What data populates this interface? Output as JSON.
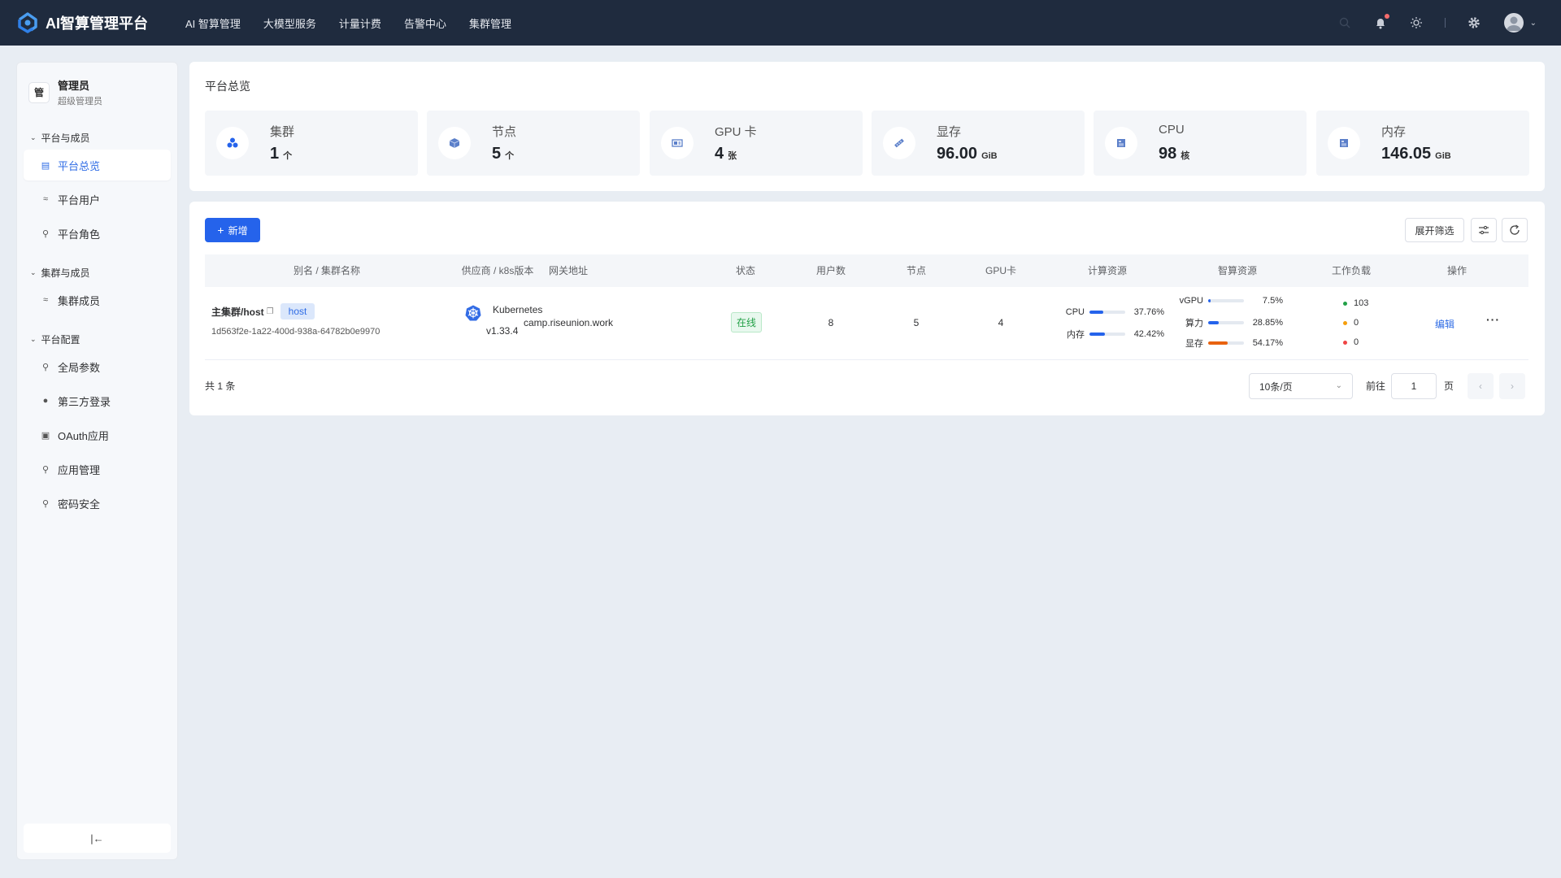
{
  "app": {
    "title": "AI智算管理平台",
    "nav": [
      "AI 智算管理",
      "大模型服务",
      "计量计费",
      "告警中心",
      "集群管理"
    ]
  },
  "user": {
    "avatar_text": "管",
    "name": "管理员",
    "role": "超级管理员"
  },
  "sidebar": {
    "groups": [
      {
        "title": "平台与成员",
        "items": [
          {
            "label": "平台总览",
            "icon": "dashboard-icon",
            "active": true
          },
          {
            "label": "平台用户",
            "icon": "user-group-icon"
          },
          {
            "label": "平台角色",
            "icon": "user-role-icon"
          }
        ]
      },
      {
        "title": "集群与成员",
        "items": [
          {
            "label": "集群成员",
            "icon": "member-icon"
          }
        ]
      },
      {
        "title": "平台配置",
        "items": [
          {
            "label": "全局参数",
            "icon": "key-icon"
          },
          {
            "label": "第三方登录",
            "icon": "login-icon"
          },
          {
            "label": "OAuth应用",
            "icon": "app-icon"
          },
          {
            "label": "应用管理",
            "icon": "key-icon"
          },
          {
            "label": "密码安全",
            "icon": "key-icon"
          }
        ]
      }
    ],
    "collapse_label": "|←"
  },
  "overview": {
    "title": "平台总览",
    "stats": [
      {
        "label": "集群",
        "value": "1",
        "unit": "个",
        "icon": "cluster-icon"
      },
      {
        "label": "节点",
        "value": "5",
        "unit": "个",
        "icon": "node-icon"
      },
      {
        "label": "GPU 卡",
        "value": "4",
        "unit": "张",
        "icon": "gpu-icon"
      },
      {
        "label": "显存",
        "value": "96.00",
        "unit": "GiB",
        "icon": "memory-stick-icon"
      },
      {
        "label": "CPU",
        "value": "98",
        "unit": "核",
        "icon": "cpu-icon"
      },
      {
        "label": "内存",
        "value": "146.05",
        "unit": "GiB",
        "icon": "ram-icon"
      }
    ]
  },
  "clusters": {
    "new_button": "新增",
    "filter_button": "展开筛选",
    "headers": [
      "别名 / 集群名称",
      "供应商 / k8s版本",
      "网关地址",
      "状态",
      "用户数",
      "节点",
      "GPU卡",
      "计算资源",
      "智算资源",
      "工作负载",
      "操作"
    ],
    "rows": [
      {
        "alias": "主集群/host",
        "tag": "host",
        "cluster_id": "1d563f2e-1a22-400d-938a-64782b0e9970",
        "provider": "Kubernetes",
        "version": "v1.33.4",
        "gateway": "camp.riseunion.work",
        "status": "在线",
        "users": "8",
        "nodes": "5",
        "gpus": "4",
        "compute": [
          {
            "label": "CPU",
            "value": "37.76%",
            "percent": 37.76,
            "color": "#2563eb"
          },
          {
            "label": "内存",
            "value": "42.42%",
            "percent": 42.42,
            "color": "#2563eb"
          }
        ],
        "ai": [
          {
            "label": "vGPU",
            "value": "7.5%",
            "percent": 7.5,
            "color": "#2563eb"
          },
          {
            "label": "算力",
            "value": "28.85%",
            "percent": 28.85,
            "color": "#2563eb"
          },
          {
            "label": "显存",
            "value": "54.17%",
            "percent": 54.17,
            "color": "#e8620f"
          }
        ],
        "workload": [
          {
            "value": "103",
            "color": "#22a047"
          },
          {
            "value": "0",
            "color": "#f59e0b"
          },
          {
            "value": "0",
            "color": "#ef4444"
          }
        ],
        "edit": "编辑",
        "more": "···"
      }
    ],
    "total": "共 1 条",
    "page_size": "10条/页",
    "goto_label": "前往",
    "page_value": "1",
    "page_label": "页"
  },
  "colors": {
    "topbar": "#1f2b3e",
    "primary": "#2563eb",
    "success": "#22a047",
    "warning": "#f59e0b",
    "danger": "#ef4444"
  }
}
